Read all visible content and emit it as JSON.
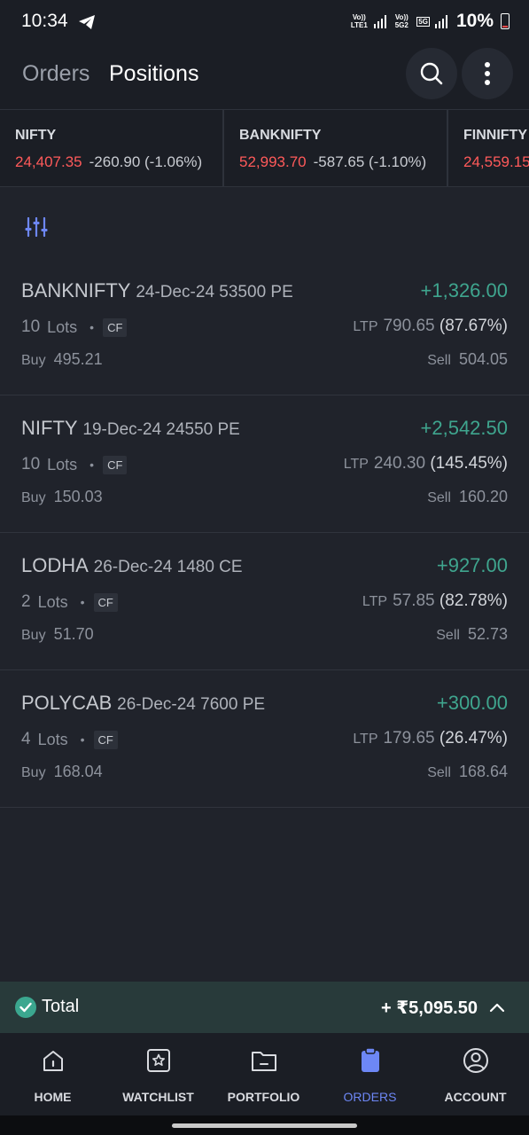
{
  "status_bar": {
    "time": "10:34",
    "net1": "Vo)) LTE1",
    "net2": "Vo)) 5G2",
    "net_type": "5G",
    "battery": "10%"
  },
  "header": {
    "tabs": [
      {
        "label": "Orders",
        "active": false
      },
      {
        "label": "Positions",
        "active": true
      }
    ],
    "icons": {
      "search": "search-icon",
      "more": "more-vertical-icon"
    }
  },
  "indices": [
    {
      "name": "NIFTY",
      "price": "24,407.35",
      "change": "-260.90 (-1.06%)"
    },
    {
      "name": "BANKNIFTY",
      "price": "52,993.70",
      "change": "-587.65 (-1.10%)"
    },
    {
      "name": "FINNIFTY",
      "price": "24,559.15",
      "change": ""
    }
  ],
  "positions": [
    {
      "symbol": "BANKNIFTY",
      "contract": "24-Dec-24 53500 PE",
      "pnl": "+1,326.00",
      "lots_count": "10",
      "lots_label": "Lots",
      "badge": "CF",
      "ltp_label": "LTP",
      "ltp": "790.65",
      "ltp_pct": "(87.67%)",
      "buy_label": "Buy",
      "buy": "495.21",
      "sell_label": "Sell",
      "sell": "504.05"
    },
    {
      "symbol": "NIFTY",
      "contract": "19-Dec-24 24550 PE",
      "pnl": "+2,542.50",
      "lots_count": "10",
      "lots_label": "Lots",
      "badge": "CF",
      "ltp_label": "LTP",
      "ltp": "240.30",
      "ltp_pct": "(145.45%)",
      "buy_label": "Buy",
      "buy": "150.03",
      "sell_label": "Sell",
      "sell": "160.20"
    },
    {
      "symbol": "LODHA",
      "contract": "26-Dec-24 1480 CE",
      "pnl": "+927.00",
      "lots_count": "2",
      "lots_label": "Lots",
      "badge": "CF",
      "ltp_label": "LTP",
      "ltp": "57.85",
      "ltp_pct": "(82.78%)",
      "buy_label": "Buy",
      "buy": "51.70",
      "sell_label": "Sell",
      "sell": "52.73"
    },
    {
      "symbol": "POLYCAB",
      "contract": "26-Dec-24 7600 PE",
      "pnl": "+300.00",
      "lots_count": "4",
      "lots_label": "Lots",
      "badge": "CF",
      "ltp_label": "LTP",
      "ltp": "179.65",
      "ltp_pct": "(26.47%)",
      "buy_label": "Buy",
      "buy": "168.04",
      "sell_label": "Sell",
      "sell": "168.64"
    }
  ],
  "total": {
    "label": "Total",
    "value": "+ ₹5,095.50"
  },
  "nav": [
    {
      "label": "HOME",
      "icon": "home-icon",
      "active": false
    },
    {
      "label": "WATCHLIST",
      "icon": "star-icon",
      "active": false
    },
    {
      "label": "PORTFOLIO",
      "icon": "folder-icon",
      "active": false
    },
    {
      "label": "ORDERS",
      "icon": "clipboard-icon",
      "active": true
    },
    {
      "label": "ACCOUNT",
      "icon": "user-icon",
      "active": false
    }
  ],
  "colors": {
    "background": "#20232b",
    "loss": "#ff5a5a",
    "profit": "#3fa58e",
    "accent": "#6d87f5"
  }
}
